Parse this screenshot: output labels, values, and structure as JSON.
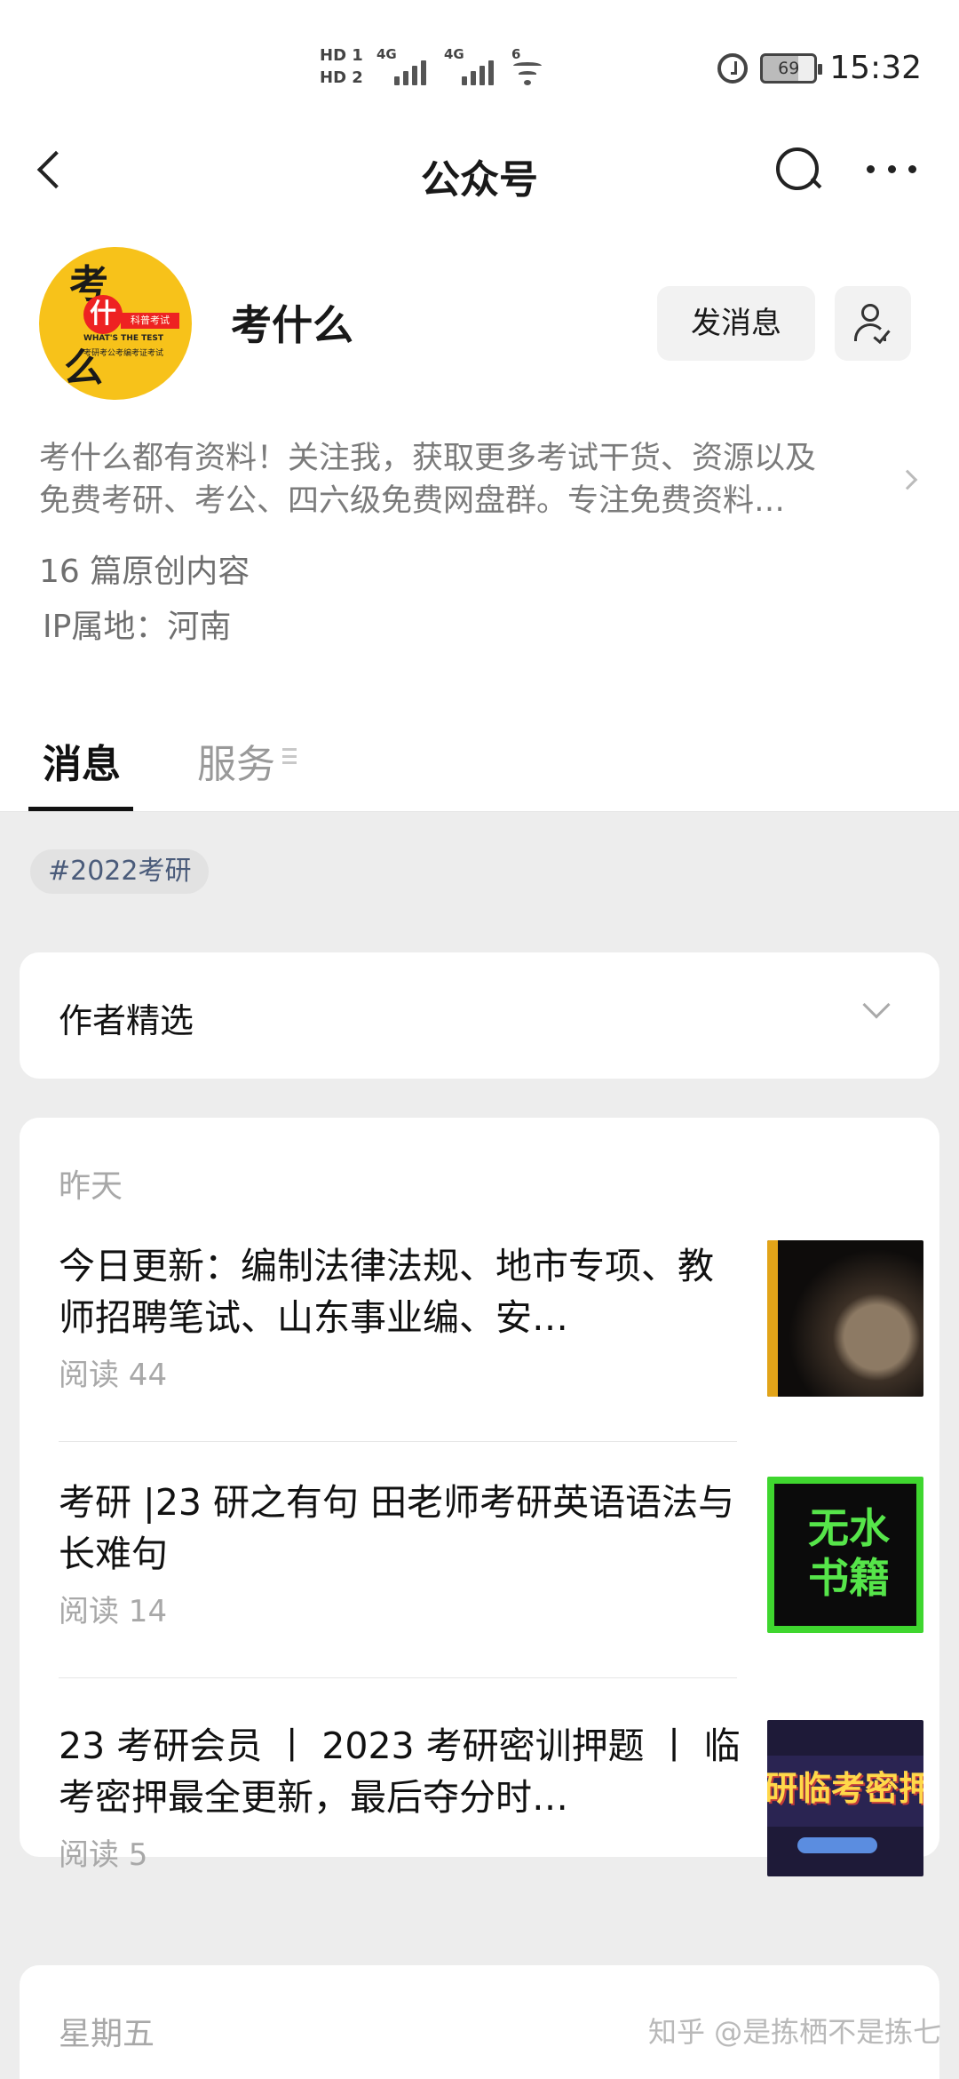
{
  "status_bar": {
    "hd1": "HD 1",
    "hd2": "HD 2",
    "network1": "4G",
    "network2": "4G",
    "wifi_label": "6",
    "battery": "69",
    "time": "15:32",
    "icons": [
      "alarm-icon",
      "battery-icon",
      "wifi-icon",
      "signal-icon"
    ]
  },
  "nav": {
    "title": "公众号",
    "icons": [
      "back-icon",
      "search-icon",
      "more-icon"
    ]
  },
  "profile": {
    "avatar_text": {
      "line1": "考",
      "line2": "什",
      "line3": "么",
      "tag": "科普考试",
      "en": "WHAT'S THE TEST",
      "sub": "考研考公考编考证考试"
    },
    "name": "考什么",
    "message_button": "发消息",
    "description_line1": "考什么都有资料！关注我，获取更多考试干货、资源以及",
    "description_line2": "免费考研、考公、四六级免费网盘群。专注免费资料…",
    "article_count": "16 篇原创内容",
    "ip_location": "IP属地：河南"
  },
  "tabs": [
    {
      "label": "消息",
      "active": true
    },
    {
      "label": "服务",
      "active": false
    }
  ],
  "feed": {
    "hashtag": "#2022考研",
    "author_select": "作者精选",
    "groups": [
      {
        "day": "昨天",
        "articles": [
          {
            "title": "今日更新：编制法律法规、地市专项、教师招聘笔试、山东事业编、安…",
            "reads": "阅读 44"
          },
          {
            "title": "考研 |23 研之有句 田老师考研英语语法与长难句",
            "reads": "阅读 14",
            "thumb_text": [
              "无水",
              "书籍"
            ]
          },
          {
            "title": "23 考研会员 丨 2023 考研密训押题 丨 临考密押最全更新，最后夺分时…",
            "reads": "阅读 5",
            "thumb_text": "研临考密押"
          }
        ]
      },
      {
        "day": "星期五"
      }
    ]
  },
  "watermark": "知乎 @是拣栖不是拣七",
  "colors": {
    "background_feed": "#ededed",
    "avatar_yellow": "#f7c21a",
    "hashtag_text": "#4a5b7a",
    "secondary_text": "#a8a8a8"
  }
}
